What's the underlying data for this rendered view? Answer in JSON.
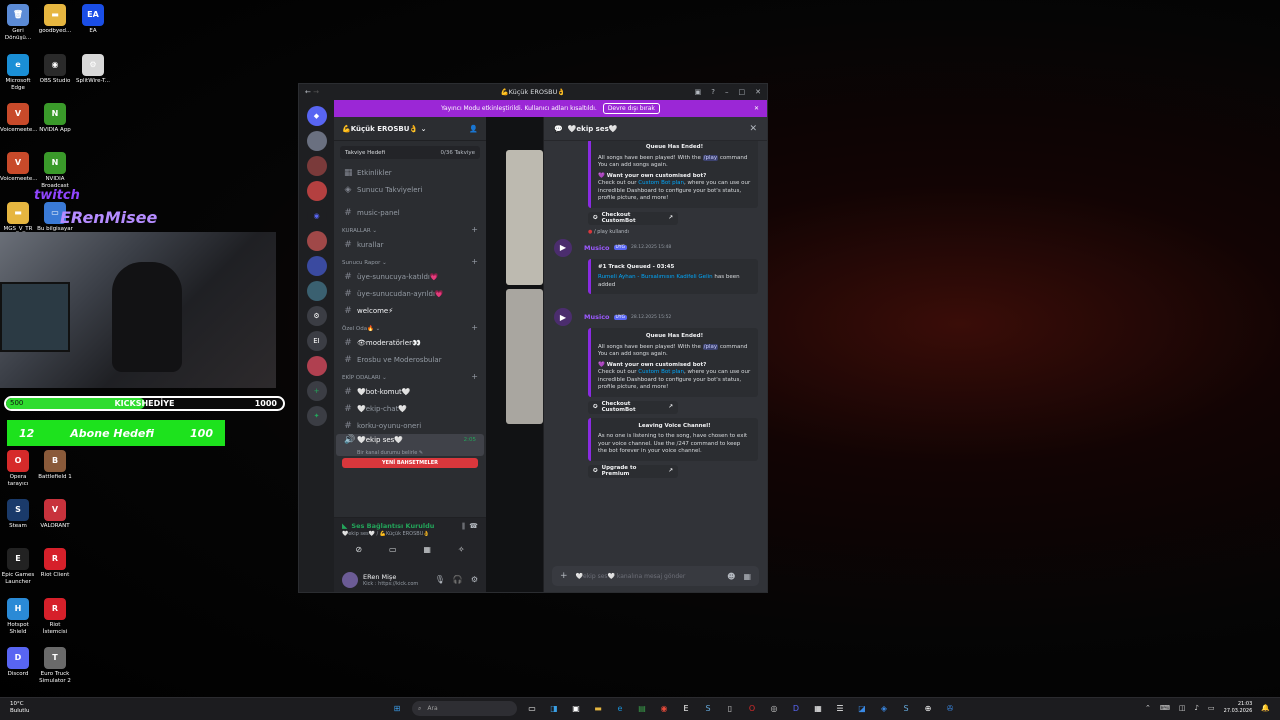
{
  "desktop": {
    "icons": [
      {
        "label": "Geri Dönüşü...",
        "glyph": "🗑",
        "color": "#5b8bd6"
      },
      {
        "label": "goodbyed...",
        "glyph": "▬",
        "color": "#e6b640"
      },
      {
        "label": "EA",
        "glyph": "EA",
        "color": "#1a4ee6"
      },
      {
        "label": "Microsoft Edge",
        "glyph": "e",
        "color": "#1a8fd6"
      },
      {
        "label": "OBS Studio",
        "glyph": "◉",
        "color": "#2a2a2a"
      },
      {
        "label": "SplitWire-T...",
        "glyph": "⚙",
        "color": "#d8d8d8"
      },
      {
        "label": "Voicemeete...",
        "glyph": "V",
        "color": "#c84a2a"
      },
      {
        "label": "NVIDIA App",
        "glyph": "N",
        "color": "#3a9a2a"
      },
      {
        "label": "Voicemeete...",
        "glyph": "V",
        "color": "#c84a2a"
      },
      {
        "label": "NVIDIA Broadcast",
        "glyph": "N",
        "color": "#3a9a2a"
      },
      {
        "label": "MGS_V_TR",
        "glyph": "▬",
        "color": "#e6b640"
      },
      {
        "label": "Bu bilgisayar",
        "glyph": "▭",
        "color": "#3a7ad6"
      },
      {
        "label": "Opera tarayıcı",
        "glyph": "O",
        "color": "#d62a2a"
      },
      {
        "label": "Battlefield 1",
        "glyph": "B",
        "color": "#8a5a3a"
      },
      {
        "label": "Steam",
        "glyph": "S",
        "color": "#1a3a6a"
      },
      {
        "label": "VALORANT",
        "glyph": "V",
        "color": "#c8323c"
      },
      {
        "label": "Epic Games Launcher",
        "glyph": "E",
        "color": "#222"
      },
      {
        "label": "Riot Client",
        "glyph": "R",
        "color": "#d6202a"
      },
      {
        "label": "Hotspot Shield",
        "glyph": "H",
        "color": "#2a8ad6"
      },
      {
        "label": "Riot İstemcisi",
        "glyph": "R",
        "color": "#d6202a"
      },
      {
        "label": "Discord",
        "glyph": "D",
        "color": "#5865f2"
      },
      {
        "label": "Euro Truck Simulator 2",
        "glyph": "T",
        "color": "#6a6a6a"
      }
    ]
  },
  "overlay": {
    "twitch_logo": "twitch",
    "twitch_name": "ERenMisee",
    "hediye_label": "KICKSHEDİYE",
    "hediye_left": "500",
    "hediye_right": "1000",
    "hediye_progress": 0.5,
    "abone_left": "12",
    "abone_label": "Abone Hedefi",
    "abone_right": "100"
  },
  "discord": {
    "window_title": "💪Küçük EROSBU👌",
    "banner": {
      "text": "Yayıncı Modu etkinleştirildi. Kullanıcı adları kısaltıldı.",
      "button": "Devre dışı bırak"
    },
    "server": {
      "name": "💪Küçük EROSBU👌",
      "boost_label": "Takviye Hedefi",
      "boost_count": "0/36 Takviye"
    },
    "top_items": [
      "Etkinlikler",
      "Sunucu Takviyeleri"
    ],
    "channels": [
      {
        "type": "channel",
        "name": "music-panel",
        "bright": false
      },
      {
        "type": "category",
        "name": "KURALLAR"
      },
      {
        "type": "channel",
        "name": "kurallar",
        "bright": false
      },
      {
        "type": "category",
        "name": "Sunucu Rapor"
      },
      {
        "type": "channel",
        "name": "üye-sunucuya-katıldı💗",
        "bright": false
      },
      {
        "type": "channel",
        "name": "üye-sunucudan-ayrıldı💗",
        "bright": false
      },
      {
        "type": "channel",
        "name": "welcome⚡",
        "bright": true
      },
      {
        "type": "category",
        "name": "Özel Oda🔥"
      },
      {
        "type": "channel",
        "name": "👁moderatörler👀",
        "bright": true
      },
      {
        "type": "channel",
        "name": "Erosbu ve Moderosbular",
        "bright": false
      },
      {
        "type": "category",
        "name": "EKİP ODALARI"
      },
      {
        "type": "channel",
        "name": "🤍bot-komut🤍",
        "bright": true
      },
      {
        "type": "channel",
        "name": "🤍ekip-chat🤍",
        "bright": false
      },
      {
        "type": "channel",
        "name": "korku-oyunu-oneri",
        "bright": false
      }
    ],
    "selected_channel": {
      "name": "🤍ekip ses🤍",
      "count": "2:05",
      "sub": "Bir kanal durumu belirle ✎"
    },
    "red_bar": "YENİ BAHSETMELER",
    "voice": {
      "status": "Ses Bağlantısı Kuruldu",
      "sub": "🤍ekip ses🤍 / 💪Küçük EROSBU👌"
    },
    "user": {
      "name": "ERen Mişe",
      "status": "Kick : https://kick.com"
    },
    "thread": {
      "title": "🤍ekip ses🤍",
      "bot_name": "Musico",
      "bot_badge": "UYG",
      "msg_time_1": "28.12.2025 15:48",
      "msg_time_2": "28.12.2025 15:52",
      "reply_text": "/ play kullandı",
      "embed_queue_title": "Queue Has Ended!",
      "embed_queue_1": "All songs have been played! With the",
      "embed_queue_cmd": "/play",
      "embed_queue_2": "command You can add songs again.",
      "embed_custom_title": "💜 Want your own customised bot?",
      "embed_custom_1": "Check out our",
      "embed_custom_link": "Custom Bot plan",
      "embed_custom_2": ", where you can use our incredible Dashboard to configure your bot's status, profile picture, and more!",
      "checkout_btn": "Checkout CustomBot",
      "track_title": "#1 Track Queued - 03:45",
      "track_song": "Rumeli Ayhan - Bursalımısın Kadifeli Gelin",
      "track_tail": "has been added",
      "leave_title": "Leaving Voice Channel!",
      "leave_text": "As no one is listening to the song, have chosen to exit your voice channel. Use the /247 command to keep the bot forever in your voice channel.",
      "premium_btn": "Upgrade to Premium",
      "composer_placeholder": "🤍ekip ses🤍 kanalına mesaj gönder"
    }
  },
  "taskbar": {
    "temp": "10°C",
    "weather": "Bulutlu",
    "search_placeholder": "Ara",
    "time": "21:03",
    "date": "27.03.2026"
  }
}
